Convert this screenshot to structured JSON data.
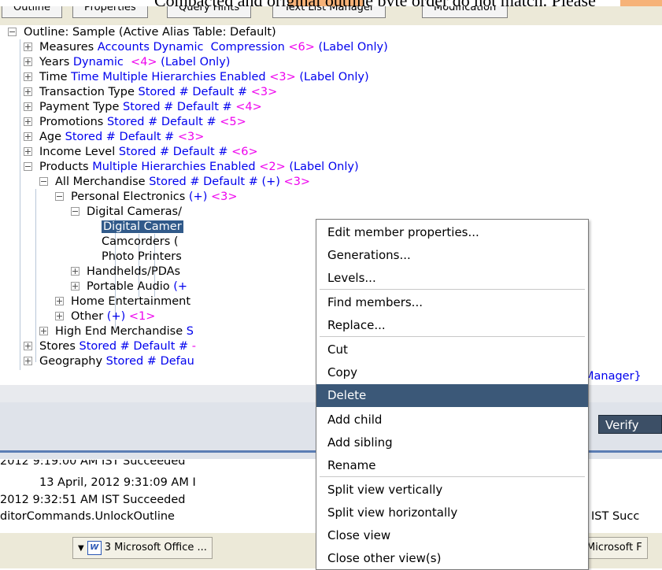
{
  "banner": {
    "text": "Compacted and original outline byte order do not match. Please"
  },
  "tabs": [
    "Outline",
    "Properties",
    "Query Hints",
    "Text List Manager",
    "Modification"
  ],
  "tree": [
    {
      "exp": "minus",
      "parts": [
        {
          "t": "Outline: Sample (Active Alias Table: Default)",
          "c": "black"
        }
      ]
    },
    {
      "exp": "plus",
      "parts": [
        {
          "t": "Measures ",
          "c": "black"
        },
        {
          "t": "Accounts Dynamic  Compression ",
          "c": "blue"
        },
        {
          "t": "<6>",
          "c": "mag"
        },
        {
          "t": " (Label Only)",
          "c": "blue"
        }
      ]
    },
    {
      "exp": "plus",
      "parts": [
        {
          "t": "Years ",
          "c": "black"
        },
        {
          "t": "Dynamic  ",
          "c": "blue"
        },
        {
          "t": "<4>",
          "c": "mag"
        },
        {
          "t": " (Label Only)",
          "c": "blue"
        }
      ]
    },
    {
      "exp": "plus",
      "parts": [
        {
          "t": "Time ",
          "c": "black"
        },
        {
          "t": "Time Multiple Hierarchies Enabled ",
          "c": "blue"
        },
        {
          "t": "<3>",
          "c": "mag"
        },
        {
          "t": " (Label Only)",
          "c": "blue"
        }
      ]
    },
    {
      "exp": "plus",
      "parts": [
        {
          "t": "Transaction Type ",
          "c": "black"
        },
        {
          "t": "Stored # Default # ",
          "c": "blue"
        },
        {
          "t": "<3>",
          "c": "mag"
        }
      ]
    },
    {
      "exp": "plus",
      "parts": [
        {
          "t": "Payment Type ",
          "c": "black"
        },
        {
          "t": "Stored # Default # ",
          "c": "blue"
        },
        {
          "t": "<4>",
          "c": "mag"
        }
      ]
    },
    {
      "exp": "plus",
      "parts": [
        {
          "t": "Promotions ",
          "c": "black"
        },
        {
          "t": "Stored # Default # ",
          "c": "blue"
        },
        {
          "t": "<5>",
          "c": "mag"
        }
      ]
    },
    {
      "exp": "plus",
      "parts": [
        {
          "t": "Age ",
          "c": "black"
        },
        {
          "t": "Stored # Default # ",
          "c": "blue"
        },
        {
          "t": "<3>",
          "c": "mag"
        }
      ]
    },
    {
      "exp": "plus",
      "parts": [
        {
          "t": "Income Level ",
          "c": "black"
        },
        {
          "t": "Stored # Default # ",
          "c": "blue"
        },
        {
          "t": "<6>",
          "c": "mag"
        }
      ]
    },
    {
      "exp": "minus",
      "parts": [
        {
          "t": "Products ",
          "c": "black"
        },
        {
          "t": "Multiple Hierarchies Enabled ",
          "c": "blue"
        },
        {
          "t": "<2>",
          "c": "mag"
        },
        {
          "t": " (Label Only)",
          "c": "blue"
        }
      ]
    },
    {
      "exp": "minus",
      "parts": [
        {
          "t": "All Merchandise ",
          "c": "black"
        },
        {
          "t": "Stored # Default # (+) ",
          "c": "blue"
        },
        {
          "t": "<3>",
          "c": "mag"
        }
      ]
    },
    {
      "exp": "minus",
      "parts": [
        {
          "t": "Personal Electronics ",
          "c": "black"
        },
        {
          "t": "(+) ",
          "c": "blue"
        },
        {
          "t": "<3>",
          "c": "mag"
        }
      ]
    },
    {
      "exp": "minus",
      "parts": [
        {
          "t": "Digital Cameras/",
          "c": "black"
        }
      ]
    },
    {
      "exp": "none",
      "parts": [
        {
          "t": "Digital Camer",
          "c": "sel"
        }
      ]
    },
    {
      "exp": "none",
      "parts": [
        {
          "t": "Camcorders (",
          "c": "black"
        }
      ]
    },
    {
      "exp": "none",
      "parts": [
        {
          "t": "Photo Printers",
          "c": "black"
        }
      ]
    },
    {
      "exp": "plus",
      "parts": [
        {
          "t": "Handhelds/PDAs",
          "c": "black"
        }
      ]
    },
    {
      "exp": "plus",
      "parts": [
        {
          "t": "Portable Audio ",
          "c": "black"
        },
        {
          "t": "(+",
          "c": "blue"
        }
      ]
    },
    {
      "exp": "plus",
      "parts": [
        {
          "t": "Home Entertainment",
          "c": "black"
        }
      ]
    },
    {
      "exp": "plus",
      "parts": [
        {
          "t": "Other ",
          "c": "black"
        },
        {
          "t": "(+) ",
          "c": "blue"
        },
        {
          "t": "<1>",
          "c": "mag"
        }
      ]
    },
    {
      "exp": "plus",
      "parts": [
        {
          "t": "High End Merchandise ",
          "c": "black"
        },
        {
          "t": "S",
          "c": "blue"
        }
      ]
    },
    {
      "exp": "plus",
      "parts": [
        {
          "t": "Stores ",
          "c": "black"
        },
        {
          "t": "Stored # Default # ",
          "c": "blue"
        },
        {
          "t": "-",
          "c": "mag"
        }
      ]
    },
    {
      "exp": "plus",
      "parts": [
        {
          "t": "Geography ",
          "c": "black"
        },
        {
          "t": "Stored # Defau",
          "c": "blue"
        }
      ]
    }
  ],
  "tree_right_fragments": [
    "Manager}"
  ],
  "toolbar": {
    "verify_label": "Verify"
  },
  "log": {
    "line1": "2012 9:19:00 AM IST Succeeded",
    "line2": "13 April, 2012 9:31:09 AM I",
    "line3": "2012 9:32:51 AM IST Succeeded",
    "line4": "ditorCommands.UnlockOutline",
    "right_fragment": "IST Succ"
  },
  "taskbar": {
    "office_label": "3 Microsoft Office ...",
    "right_label": "Microsoft F"
  },
  "context_menu": {
    "items": [
      "Edit member properties...",
      "Generations...",
      "Levels...",
      "Find members...",
      "Replace...",
      "Cut",
      "Copy",
      "Delete",
      "Add child",
      "Add sibling",
      "Rename",
      "Split view vertically",
      "Split view horizontally",
      "Close view",
      "Close other view(s)"
    ],
    "selected": "Delete"
  },
  "colors": {
    "selection": "#3b5878",
    "blue_text": "#0000ee",
    "magenta_text": "#ee00ee"
  }
}
